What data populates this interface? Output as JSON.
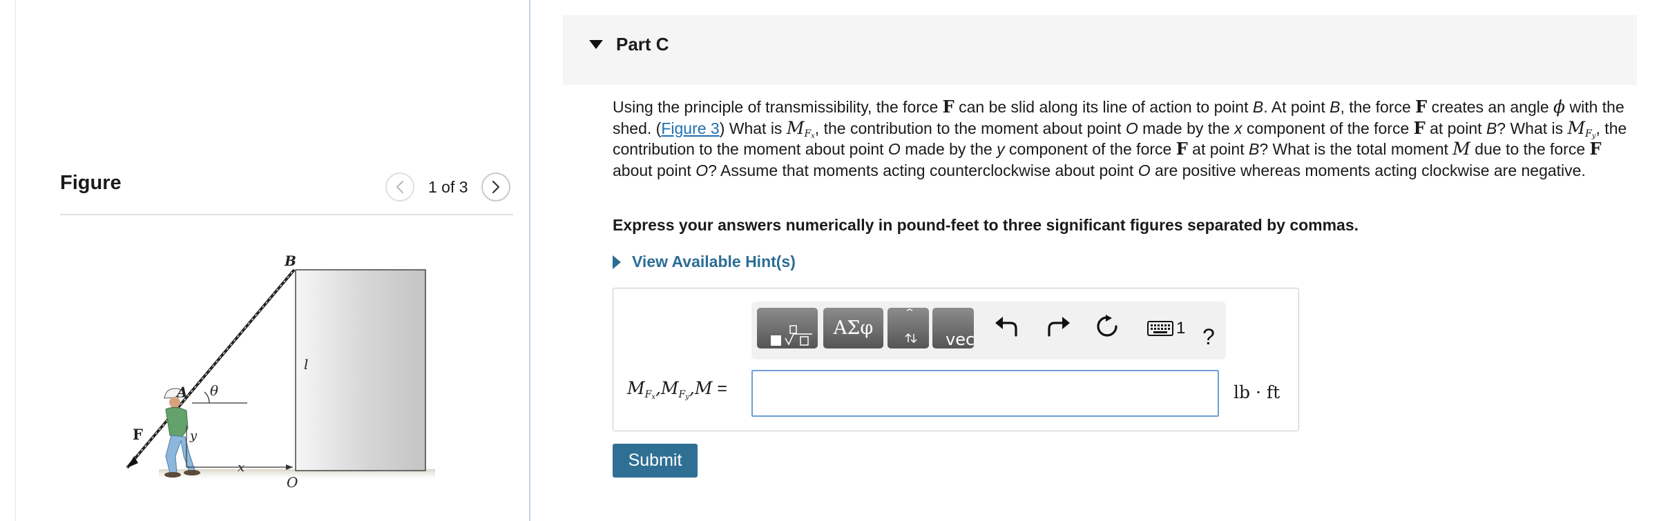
{
  "figure_panel": {
    "title": "Figure",
    "page_indicator": "1 of 3",
    "diagram_labels": {
      "point_b": "B",
      "point_a": "A",
      "angle": "θ",
      "force": "F",
      "height": "l",
      "y_dim": "y",
      "x_dim": "x",
      "origin": "O"
    }
  },
  "part": {
    "title": "Part C"
  },
  "question": {
    "s1": "Using the principle of transmissibility, the force ",
    "f1": "F",
    "s2": " can be slid along its line of action to point ",
    "b1": "B",
    "s3": ". At point ",
    "b2": "B",
    "s4": ", the force ",
    "f2": "F",
    "s5": " creates an angle ",
    "phi": "ϕ",
    "s6": " with the shed. (",
    "figure_link": "Figure 3",
    "s7": ") What is ",
    "mfx_m": "M",
    "mfx_f": "F",
    "mfx_x": "x",
    "s8": ", the contribution to the moment about point ",
    "o1": "O",
    "s9": " made by the ",
    "x_word": "x",
    "s10": " component of the force ",
    "f3": "F",
    "s11": " at point ",
    "b3": "B",
    "s12": "? What is ",
    "mfy_m": "M",
    "mfy_f": "F",
    "mfy_y": "y",
    "s13": ", the contribution to the moment about point ",
    "o2": "O",
    "s14": " made by the ",
    "y_word": "y",
    "s15": " component of the force ",
    "f4": "F",
    "s16": " at point ",
    "b4": "B",
    "s17": "? What is the total moment ",
    "m_total": "M",
    "s18": " due to the force ",
    "f5": "F",
    "s19": " about point ",
    "o3": "O",
    "s20": "? Assume that moments acting counterclockwise about point ",
    "o4": "O",
    "s21": " are positive whereas moments acting clockwise are negative."
  },
  "instruction": "Express your answers numerically in pound-feet to three significant figures separated by commas.",
  "hint_label": "View Available Hint(s)",
  "answer": {
    "label": {
      "m1": "M",
      "f1": "F",
      "x": "x",
      "c1": ",",
      "m2": "M",
      "f2": "F",
      "y": "y",
      "c2": ",",
      "m3": "M",
      "eq": " ="
    },
    "value": "",
    "units": "lb · ft",
    "toolbar": {
      "greek_label": "ΑΣφ",
      "vec_label": "vec",
      "help_label": "?",
      "keyboard_digit": "1",
      "icons": [
        "templates-icon",
        "greek-letters-icon",
        "subscript-icon",
        "vector-icon",
        "undo-icon",
        "redo-icon",
        "reset-icon",
        "keyboard-icon",
        "help-icon"
      ]
    }
  },
  "submit_label": "Submit",
  "colors": {
    "accent": "#2f6f94",
    "link": "#1f6fb2",
    "hint": "#2b6d96",
    "input_border": "#6e9ed4"
  }
}
